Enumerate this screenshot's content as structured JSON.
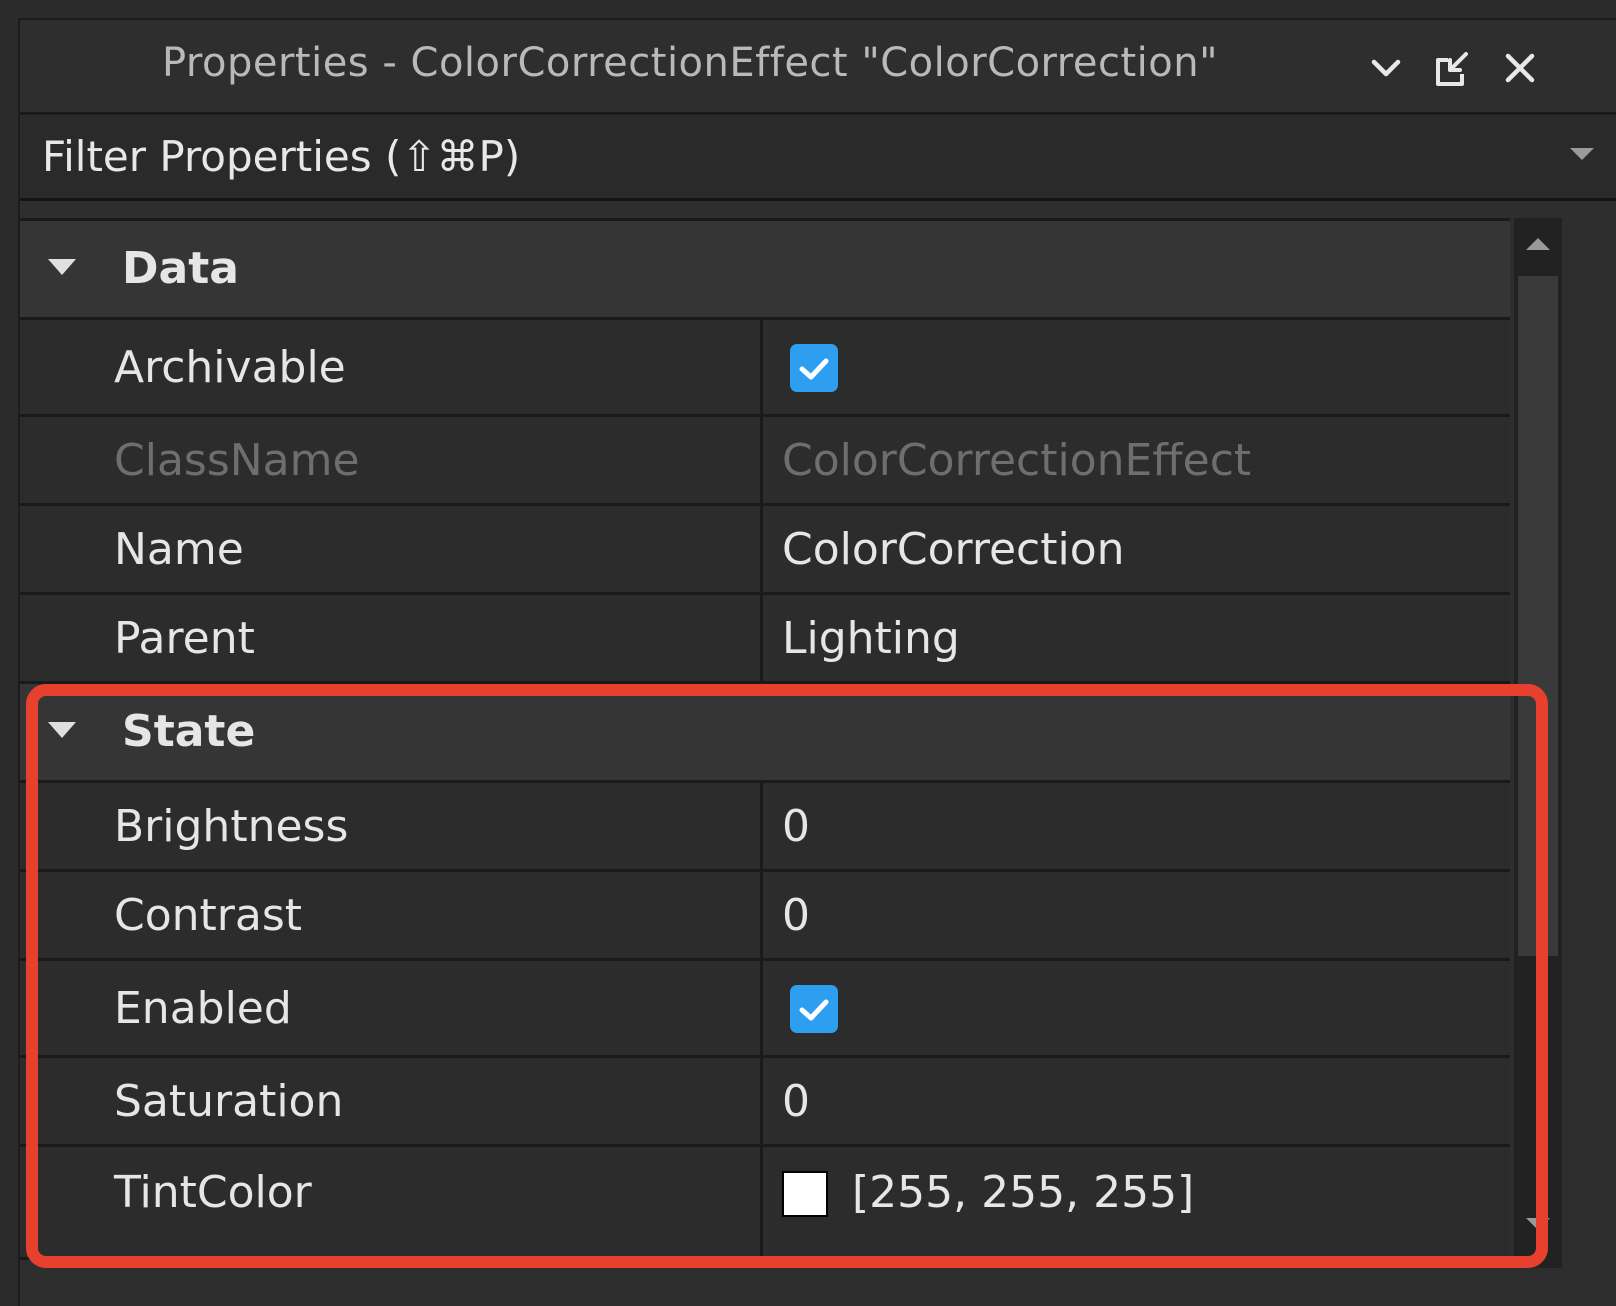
{
  "window": {
    "title": "Properties - ColorCorrectionEffect \"ColorCorrection\"",
    "buttons": {
      "dropdown_icon": "chevron-down-icon",
      "undock_icon": "undock-icon",
      "close_icon": "close-icon"
    }
  },
  "filter": {
    "placeholder": "Filter Properties (⇧⌘P)"
  },
  "categories": {
    "data": {
      "label": "Data",
      "rows": [
        {
          "name": "Archivable",
          "type": "checkbox",
          "checked": true
        },
        {
          "name": "ClassName",
          "value": "ColorCorrectionEffect",
          "readonly": true
        },
        {
          "name": "Name",
          "value": "ColorCorrection"
        },
        {
          "name": "Parent",
          "value": "Lighting"
        }
      ]
    },
    "state": {
      "label": "State",
      "rows": [
        {
          "name": "Brightness",
          "value": "0"
        },
        {
          "name": "Contrast",
          "value": "0"
        },
        {
          "name": "Enabled",
          "type": "checkbox",
          "checked": true
        },
        {
          "name": "Saturation",
          "value": "0"
        },
        {
          "name": "TintColor",
          "value": "[255, 255, 255]",
          "swatch": "#ffffff"
        }
      ]
    }
  },
  "colors": {
    "accent_checkbox": "#2e9ff0",
    "highlight_border": "#e8402e"
  }
}
